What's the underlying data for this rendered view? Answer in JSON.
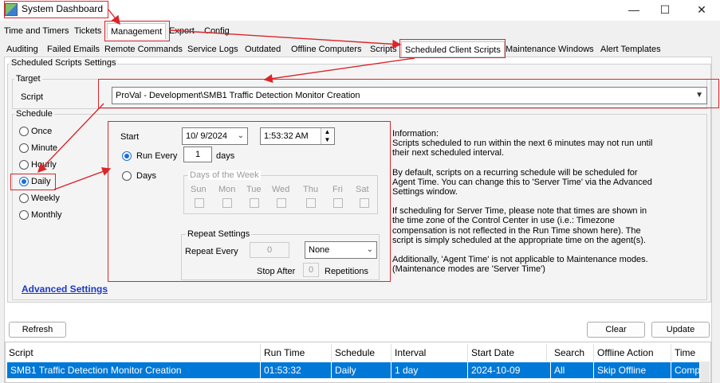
{
  "window": {
    "title": "System Dashboard",
    "minimize": "—",
    "maximize": "☐",
    "close": "✕"
  },
  "main_tabs": [
    "Time and Timers",
    "Tickets",
    "Management",
    "Export",
    "Config"
  ],
  "sub_tabs": [
    "Auditing",
    "Failed Emails",
    "Remote Commands",
    "Service Logs",
    "Outdated",
    "Offline Computers",
    "Scripts",
    "Scheduled Client Scripts",
    "Maintenance Windows",
    "Alert Templates"
  ],
  "settings": {
    "heading": "Scheduled Scripts Settings",
    "target_legend": "Target",
    "script_label": "Script",
    "script_value": "ProVal - Development\\SMB1 Traffic Detection Monitor Creation",
    "schedule_legend": "Schedule",
    "schedule_options": [
      "Once",
      "Minute",
      "Hourly",
      "Daily",
      "Weekly",
      "Monthly"
    ],
    "selected_option": "Daily",
    "start_label": "Start",
    "start_date": "10/  9/2024",
    "start_time": "1:53:32 AM",
    "run_every_label": "Run Every",
    "run_every_value": "1",
    "run_every_unit": "days",
    "days_label": "Days",
    "days_of_week_legend": "Days of the Week",
    "weekdays": [
      "Sun",
      "Mon",
      "Tue",
      "Wed",
      "Thu",
      "Fri",
      "Sat"
    ],
    "repeat_legend": "Repeat Settings",
    "repeat_every_label": "Repeat Every",
    "repeat_every_value": "0",
    "repeat_unit": "None",
    "stop_after_label": "Stop After",
    "stop_after_value": "0",
    "repetitions_label": "Repetitions",
    "advanced_link": "Advanced Settings",
    "info": {
      "line1": "Information:",
      "para1": "Scripts scheduled to run within the next 6 minutes may not run until their next scheduled interval.",
      "para2": "By default, scripts on a recurring schedule will be scheduled for Agent Time. You can change this to 'Server Time' via the Advanced Settings window.",
      "para3": "If scheduling for Server Time, please note that times are shown in the time zone of the Control Center in use (i.e.: Timezone compensation is not reflected in the Run Time shown here). The script is simply scheduled at the appropriate time on the agent(s).",
      "para4": "Additionally, 'Agent Time' is not applicable to Maintenance modes. (Maintenance modes are 'Server Time')"
    }
  },
  "buttons": {
    "refresh": "Refresh",
    "clear": "Clear",
    "update": "Update"
  },
  "table": {
    "columns": [
      "Script",
      "Run Time",
      "Schedule",
      "Interval",
      "Start Date",
      "Search",
      "Offline Action",
      "Time"
    ],
    "rows": [
      [
        "SMB1 Traffic Detection Monitor Creation",
        "01:53:32",
        "Daily",
        "1 day",
        "2024-10-09",
        "All",
        "Skip Offline",
        "Comp"
      ]
    ]
  },
  "colors": {
    "highlight": "#d9262b",
    "selection": "#0078d7",
    "link": "#1c39c8",
    "radio_accent": "#1a6fd4"
  }
}
